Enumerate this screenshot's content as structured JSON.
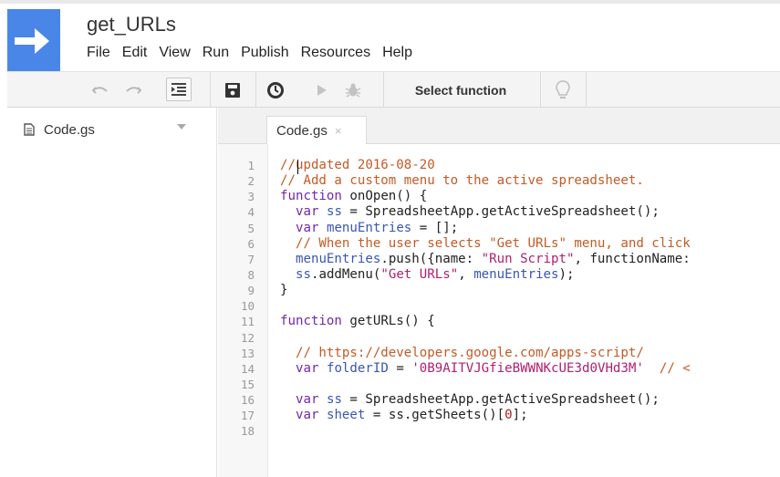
{
  "app": {
    "project_title": "get_URLs",
    "logo_icon": "arrow-right-icon",
    "brand_color": "#4a86e8"
  },
  "menu": [
    "File",
    "Edit",
    "View",
    "Run",
    "Publish",
    "Resources",
    "Help"
  ],
  "toolbar": {
    "undo_icon": "undo-icon",
    "redo_icon": "redo-icon",
    "indent_icon": "indent-icon",
    "save_icon": "save-icon",
    "triggers_icon": "clock-icon",
    "run_icon": "play-icon",
    "debug_icon": "bug-icon",
    "select_function_label": "Select function",
    "hint_icon": "lightbulb-icon"
  },
  "sidebar": {
    "files": [
      {
        "name": "Code.gs",
        "icon": "document-icon"
      }
    ]
  },
  "editor": {
    "active_tab": "Code.gs",
    "tab_close": "×",
    "lines": [
      {
        "n": "1",
        "tokens": [
          {
            "t": "//updated 2016-08-20",
            "c": "comment"
          }
        ]
      },
      {
        "n": "2",
        "tokens": [
          {
            "t": "// Add a custom menu to the active spreadsheet.",
            "c": "comment"
          }
        ]
      },
      {
        "n": "3",
        "tokens": [
          {
            "t": "function",
            "c": "keyword"
          },
          {
            "t": " onOpen() {",
            "c": "plain"
          }
        ]
      },
      {
        "n": "4",
        "tokens": [
          {
            "t": "  ",
            "c": "plain"
          },
          {
            "t": "var",
            "c": "keyword"
          },
          {
            "t": " ",
            "c": "plain"
          },
          {
            "t": "ss",
            "c": "var"
          },
          {
            "t": " = SpreadsheetApp.getActiveSpreadsheet();",
            "c": "plain"
          }
        ]
      },
      {
        "n": "5",
        "tokens": [
          {
            "t": "  ",
            "c": "plain"
          },
          {
            "t": "var",
            "c": "keyword"
          },
          {
            "t": " ",
            "c": "plain"
          },
          {
            "t": "menuEntries",
            "c": "var"
          },
          {
            "t": " = [];",
            "c": "plain"
          }
        ]
      },
      {
        "n": "6",
        "tokens": [
          {
            "t": "  // When the user selects \"Get URLs\" menu, and click",
            "c": "comment"
          }
        ]
      },
      {
        "n": "7",
        "tokens": [
          {
            "t": "  ",
            "c": "plain"
          },
          {
            "t": "menuEntries",
            "c": "var"
          },
          {
            "t": ".push({name: ",
            "c": "plain"
          },
          {
            "t": "\"Run Script\"",
            "c": "string"
          },
          {
            "t": ", functionName:",
            "c": "plain"
          }
        ]
      },
      {
        "n": "8",
        "tokens": [
          {
            "t": "  ",
            "c": "plain"
          },
          {
            "t": "ss",
            "c": "var"
          },
          {
            "t": ".addMenu(",
            "c": "plain"
          },
          {
            "t": "\"Get URLs\"",
            "c": "string"
          },
          {
            "t": ", ",
            "c": "plain"
          },
          {
            "t": "menuEntries",
            "c": "var"
          },
          {
            "t": ");",
            "c": "plain"
          }
        ]
      },
      {
        "n": "9",
        "tokens": [
          {
            "t": "}",
            "c": "plain"
          }
        ]
      },
      {
        "n": "10",
        "tokens": []
      },
      {
        "n": "11",
        "tokens": [
          {
            "t": "function",
            "c": "keyword"
          },
          {
            "t": " getURLs() {",
            "c": "plain"
          }
        ]
      },
      {
        "n": "12",
        "tokens": []
      },
      {
        "n": "13",
        "tokens": [
          {
            "t": "  // https://developers.google.com/apps-script/",
            "c": "comment"
          }
        ]
      },
      {
        "n": "14",
        "tokens": [
          {
            "t": "  ",
            "c": "plain"
          },
          {
            "t": "var",
            "c": "keyword"
          },
          {
            "t": " ",
            "c": "plain"
          },
          {
            "t": "folderID",
            "c": "var"
          },
          {
            "t": " = ",
            "c": "plain"
          },
          {
            "t": "'0B9AITVJGfieBWWNKcUE3d0VHd3M'",
            "c": "string"
          },
          {
            "t": "  // <",
            "c": "comment"
          }
        ]
      },
      {
        "n": "15",
        "tokens": []
      },
      {
        "n": "16",
        "tokens": [
          {
            "t": "  ",
            "c": "plain"
          },
          {
            "t": "var",
            "c": "keyword"
          },
          {
            "t": " ",
            "c": "plain"
          },
          {
            "t": "ss",
            "c": "var"
          },
          {
            "t": " = SpreadsheetApp.getActiveSpreadsheet();",
            "c": "plain"
          }
        ]
      },
      {
        "n": "17",
        "tokens": [
          {
            "t": "  ",
            "c": "plain"
          },
          {
            "t": "var",
            "c": "keyword"
          },
          {
            "t": " ",
            "c": "plain"
          },
          {
            "t": "sheet",
            "c": "var"
          },
          {
            "t": " = ss.getSheets()[",
            "c": "plain"
          },
          {
            "t": "0",
            "c": "number"
          },
          {
            "t": "];",
            "c": "plain"
          }
        ]
      },
      {
        "n": "18",
        "tokens": []
      }
    ]
  }
}
